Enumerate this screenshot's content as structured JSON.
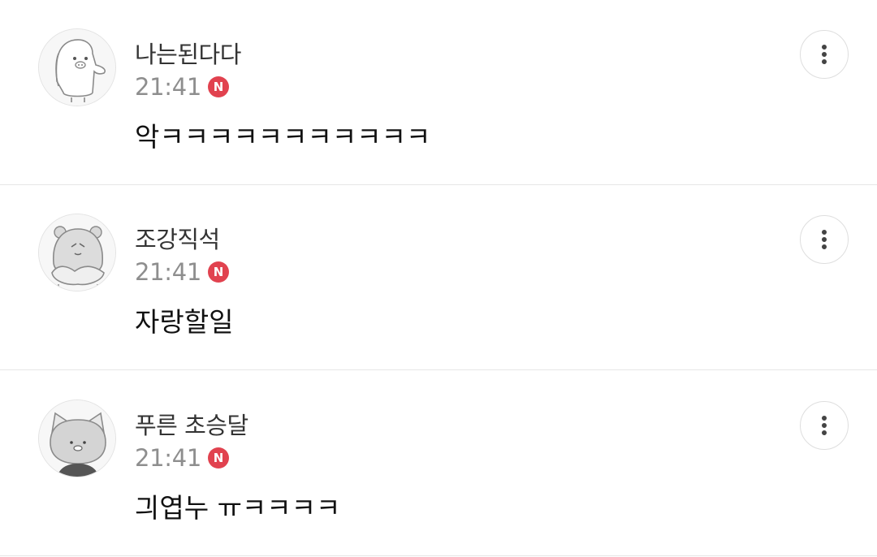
{
  "comments": [
    {
      "nickname": "나는된다다",
      "time": "21:41",
      "badge": "N",
      "text": "악ㅋㅋㅋㅋㅋㅋㅋㅋㅋㅋㅋ",
      "avatar_icon": "bear-avatar-icon"
    },
    {
      "nickname": "조강직석",
      "time": "21:41",
      "badge": "N",
      "text": "자랑할일",
      "avatar_icon": "hamster-avatar-icon"
    },
    {
      "nickname": "푸른 초승달",
      "time": "21:41",
      "badge": "N",
      "text": "긔엽누 ㅠㅋㅋㅋㅋ",
      "avatar_icon": "cat-avatar-icon"
    }
  ],
  "colors": {
    "badge": "#e1424f",
    "divider": "#e6e6e6",
    "time": "#8e8e8e"
  },
  "more_icon": "more-vertical-icon"
}
